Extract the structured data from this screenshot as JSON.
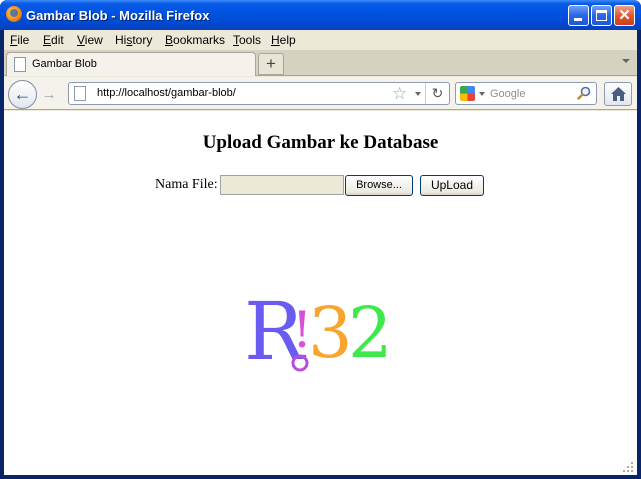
{
  "window": {
    "title": "Gambar Blob - Mozilla Firefox"
  },
  "menu": {
    "items": [
      {
        "label_pre": "",
        "label_key": "F",
        "label_post": "ile"
      },
      {
        "label_pre": "",
        "label_key": "E",
        "label_post": "dit"
      },
      {
        "label_pre": "",
        "label_key": "V",
        "label_post": "iew"
      },
      {
        "label_pre": "Hi",
        "label_key": "s",
        "label_post": "tory"
      },
      {
        "label_pre": "",
        "label_key": "B",
        "label_post": "ookmarks"
      },
      {
        "label_pre": "",
        "label_key": "T",
        "label_post": "ools"
      },
      {
        "label_pre": "",
        "label_key": "H",
        "label_post": "elp"
      }
    ]
  },
  "tabs": [
    {
      "label": "Gambar Blob"
    }
  ],
  "newtab_glyph": "+",
  "navbar": {
    "url": "http://localhost/gambar-blob/",
    "search_placeholder": "Google",
    "back_glyph": "←",
    "forward_glyph": "→",
    "reload_glyph": "↻",
    "star_glyph": "☆"
  },
  "page": {
    "title": "Upload Gambar ke Database",
    "file_label": "Nama File:",
    "browse_label": "Browse...",
    "upload_label": "UpLoad",
    "logo_text": "R!32"
  },
  "colors": {
    "titlebar_blue": "#0053e1",
    "logo_purple": "#6a5cf0",
    "logo_magenta": "#d94fd8",
    "logo_orange": "#f7a52c",
    "logo_green": "#3ee84d"
  }
}
